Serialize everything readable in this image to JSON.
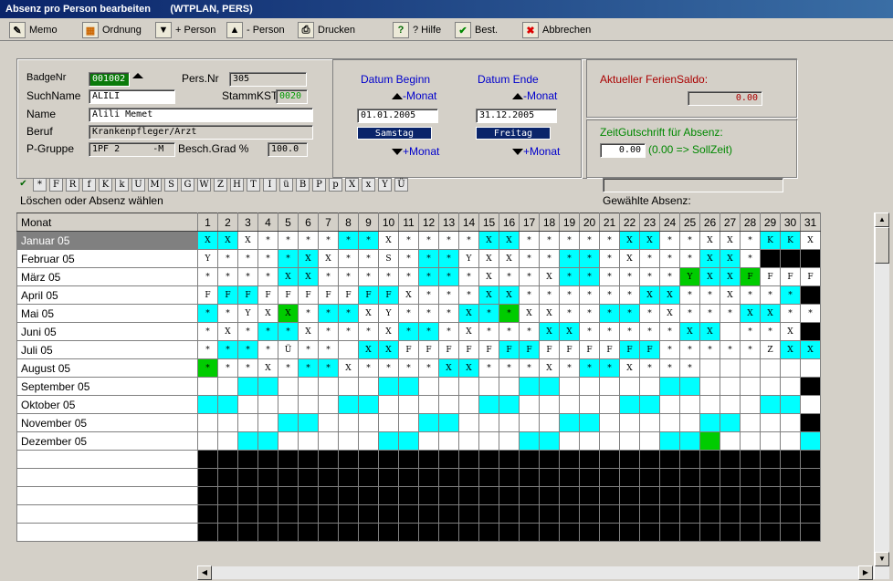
{
  "window": {
    "title": "Absenz pro Person bearbeiten",
    "subtitle": "(WTPLAN, PERS)"
  },
  "toolbar": {
    "memo": "Memo",
    "ordnung": "Ordnung",
    "plus_person": "+ Person",
    "minus_person": "- Person",
    "drucken": "Drucken",
    "hilfe": "? Hilfe",
    "best": "Best.",
    "abbrechen": "Abbrechen"
  },
  "person": {
    "badge_label": "BadgeNr",
    "badge_value": "001002",
    "persnr_label": "Pers.Nr",
    "persnr_value": "305",
    "suchname_label": "SuchName",
    "suchname_value": "ALILI",
    "stammkst_label": "StammKST",
    "stammkst_value": "0020",
    "name_label": "Name",
    "name_value": "Alili Memet",
    "beruf_label": "Beruf",
    "beruf_value": "Krankenpfleger/Arzt",
    "pgruppe_label": "P-Gruppe",
    "pgruppe_value": "1PF 2      -M",
    "besch_label": "Besch.Grad %",
    "besch_value": "100.0"
  },
  "dates": {
    "beginn_label": "Datum Beginn",
    "ende_label": "Datum Ende",
    "monat_minus": "-Monat",
    "monat_plus": "+Monat",
    "beginn_value": "01.01.2005",
    "ende_value": "31.12.2005",
    "beginn_day": "Samstag",
    "ende_day": "Freitag"
  },
  "ferien": {
    "label": "Aktueller FerienSaldo:",
    "value": "0.00",
    "zg_label": "ZeitGutschrift für Absenz:",
    "zg_value": "0.00",
    "zg_hint": "(0.00 => SollZeit)"
  },
  "codes": [
    "*",
    "F",
    "R",
    "f",
    "K",
    "k",
    "U",
    "M",
    "S",
    "G",
    "W",
    "Z",
    "H",
    "T",
    "I",
    "ü",
    "B",
    "P",
    "p",
    "X",
    "x",
    "Y",
    "Ü"
  ],
  "hint": "Löschen oder Absenz wählen",
  "gewaehlte": "Gewählte Absenz:",
  "grid": {
    "month_header": "Monat",
    "days": [
      "1",
      "2",
      "3",
      "4",
      "5",
      "6",
      "7",
      "8",
      "9",
      "10",
      "11",
      "12",
      "13",
      "14",
      "15",
      "16",
      "17",
      "18",
      "19",
      "20",
      "21",
      "22",
      "23",
      "24",
      "25",
      "26",
      "27",
      "28",
      "29",
      "30",
      "31"
    ],
    "months": [
      {
        "name": "Januar 05",
        "cells": [
          "cX",
          "cX",
          "X",
          "*",
          "*",
          "*",
          "*",
          "c*",
          "c*",
          "X",
          "*",
          "*",
          "*",
          "*",
          "cX",
          "cX",
          "*",
          "*",
          "*",
          "*",
          "*",
          "cX",
          "cX",
          "*",
          "*",
          "X",
          "X",
          "*",
          "cK",
          "cK",
          "X"
        ]
      },
      {
        "name": "Februar 05",
        "cells": [
          "Y",
          "*",
          "*",
          "*",
          "c*",
          "cX",
          "X",
          "*",
          "*",
          "S",
          "*",
          "c*",
          "c*",
          "Y",
          "X",
          "X",
          "*",
          "*",
          "c*",
          "c*",
          "*",
          "X",
          "*",
          "*",
          "*",
          "cX",
          "cX",
          "*",
          "b",
          "b",
          "b"
        ]
      },
      {
        "name": "März 05",
        "cells": [
          "*",
          "*",
          "*",
          "*",
          "cX",
          "cX",
          "*",
          "*",
          "*",
          "*",
          "*",
          "c*",
          "c*",
          "*",
          "X",
          "*",
          "*",
          "X",
          "c*",
          "c*",
          "*",
          "*",
          "*",
          "*",
          "gY",
          "cX",
          "cX",
          "gF",
          "F",
          "F",
          "F"
        ]
      },
      {
        "name": "April 05",
        "cells": [
          "F",
          "cF",
          "cF",
          "F",
          "F",
          "F",
          "F",
          "F",
          "cF",
          "cF",
          "X",
          "*",
          "*",
          "*",
          "cX",
          "cX",
          "*",
          "*",
          "*",
          "*",
          "*",
          "*",
          "cX",
          "cX",
          "*",
          "*",
          "X",
          "*",
          "*",
          "c*",
          "b"
        ]
      },
      {
        "name": "Mai 05",
        "cells": [
          "c*",
          "*",
          "Y",
          "X",
          "gX",
          "*",
          "c*",
          "c*",
          "X",
          "Y",
          "*",
          "*",
          "*",
          "cX",
          "c*",
          "g*",
          "X",
          "X",
          "*",
          "*",
          "c*",
          "c*",
          "*",
          "X",
          "*",
          "*",
          "*",
          "cX",
          "cX",
          "*",
          "*"
        ]
      },
      {
        "name": "Juni 05",
        "cells": [
          "*",
          "X",
          "*",
          "c*",
          "c*",
          "X",
          "*",
          "*",
          "*",
          "X",
          "c*",
          "c*",
          "*",
          "X",
          "*",
          "*",
          "*",
          "cX",
          "cX",
          "*",
          "*",
          "*",
          "*",
          "*",
          "cX",
          "cX",
          "",
          "*",
          "*",
          "X",
          "b"
        ]
      },
      {
        "name": "Juli 05",
        "cells": [
          "*",
          "c*",
          "c*",
          "*",
          "Ü",
          "*",
          "*",
          "",
          "cX",
          "cX",
          "F",
          "F",
          "F",
          "F",
          "F",
          "cF",
          "cF",
          "F",
          "F",
          "F",
          "F",
          "cF",
          "cF",
          "*",
          "*",
          "*",
          "*",
          "*",
          "Z",
          "cX",
          "cX"
        ]
      },
      {
        "name": "August 05",
        "cells": [
          "g*",
          "*",
          "*",
          "X",
          "*",
          "c*",
          "c*",
          "X",
          "*",
          "*",
          "*",
          "*",
          "cX",
          "cX",
          "*",
          "*",
          "*",
          "X",
          "*",
          "c*",
          "c*",
          "X",
          "*",
          "*",
          "*",
          "",
          "",
          "",
          "",
          "",
          ""
        ]
      },
      {
        "name": "September 05",
        "cells": [
          "",
          "",
          "c",
          "c",
          "",
          "",
          "",
          "",
          "",
          "c",
          "c",
          "",
          "",
          "",
          "",
          "",
          "c",
          "c",
          "",
          "",
          "",
          "",
          "",
          "c",
          "c",
          "",
          "",
          "",
          "",
          "",
          "b"
        ]
      },
      {
        "name": "Oktober 05",
        "cells": [
          "c",
          "c",
          "",
          "",
          "",
          "",
          "",
          "c",
          "c",
          "",
          "",
          "",
          "",
          "",
          "c",
          "c",
          "",
          "",
          "",
          "",
          "",
          "c",
          "c",
          "",
          "",
          "",
          "",
          "",
          "c",
          "c",
          ""
        ]
      },
      {
        "name": "November 05",
        "cells": [
          "",
          "",
          "",
          "",
          "c",
          "c",
          "",
          "",
          "",
          "",
          "",
          "c",
          "c",
          "",
          "",
          "",
          "",
          "",
          "c",
          "c",
          "",
          "",
          "",
          "",
          "",
          "c",
          "c",
          "",
          "",
          "",
          "b"
        ]
      },
      {
        "name": "Dezember 05",
        "cells": [
          "",
          "",
          "c",
          "c",
          "",
          "",
          "",
          "",
          "",
          "c",
          "c",
          "",
          "",
          "",
          "",
          "",
          "c",
          "c",
          "",
          "",
          "",
          "",
          "",
          "c",
          "c",
          "g",
          "",
          "",
          "",
          "",
          "c"
        ]
      }
    ],
    "empty_rows": 5
  }
}
